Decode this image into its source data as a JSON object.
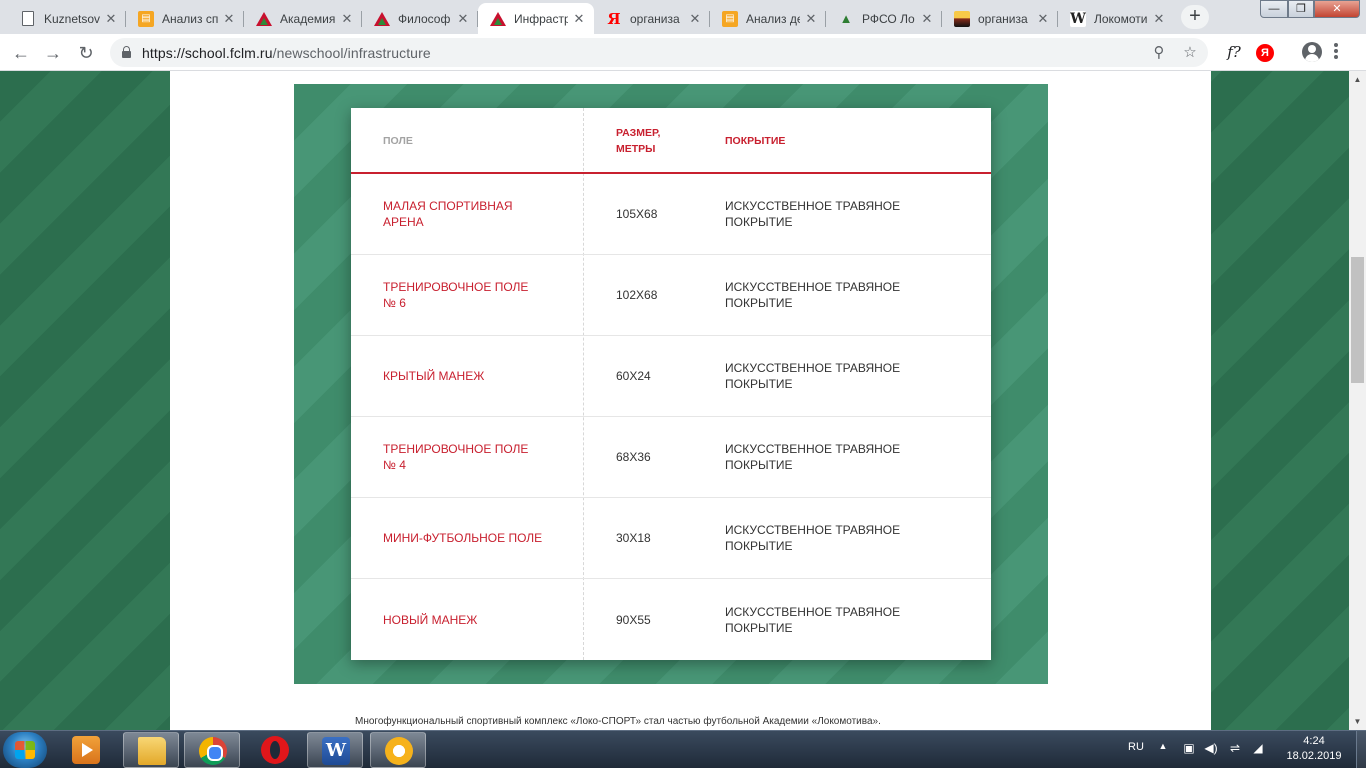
{
  "browser": {
    "tabs": [
      {
        "title": "Kuznetsov",
        "icon": "doc-icon",
        "active": false
      },
      {
        "title": "Анализ сп",
        "icon": "orange-doc-icon",
        "active": false
      },
      {
        "title": "Академия",
        "icon": "lokomotiv-icon",
        "active": false
      },
      {
        "title": "Философ",
        "icon": "lokomotiv-icon",
        "active": false
      },
      {
        "title": "Инфрастр",
        "icon": "lokomotiv-icon",
        "active": true
      },
      {
        "title": "организа",
        "icon": "yandex-icon",
        "active": false
      },
      {
        "title": "Анализ де",
        "icon": "orange-doc-icon",
        "active": false
      },
      {
        "title": "РФСО Ло",
        "icon": "tree-icon",
        "active": false
      },
      {
        "title": "организа",
        "icon": "image-icon",
        "active": false
      },
      {
        "title": "Локомоти",
        "icon": "wikipedia-icon",
        "active": false
      }
    ],
    "url_scheme_host": "https://school.fclm.ru",
    "url_path": "/newschool/infrastructure",
    "ext_fx": "f?",
    "ext_ya": "Я"
  },
  "table": {
    "headers": {
      "field": "ПОЛЕ",
      "size_line1": "РАЗМЕР,",
      "size_line2": "МЕТРЫ",
      "cover": "ПОКРЫТИЕ"
    },
    "rows": [
      {
        "name": "МАЛАЯ СПОРТИВНАЯ АРЕНА",
        "size": "105Х68",
        "cover": "ИСКУССТВЕННОЕ ТРАВЯНОЕ ПОКРЫТИЕ"
      },
      {
        "name": "ТРЕНИРОВОЧНОЕ ПОЛЕ № 6",
        "size": "102Х68",
        "cover": "ИСКУССТВЕННОЕ ТРАВЯНОЕ ПОКРЫТИЕ"
      },
      {
        "name": "КРЫТЫЙ МАНЕЖ",
        "size": "60Х24",
        "cover": "ИСКУССТВЕННОЕ ТРАВЯНОЕ ПОКРЫТИЕ"
      },
      {
        "name": "ТРЕНИРОВОЧНОЕ ПОЛЕ № 4",
        "size": "68Х36",
        "cover": "ИСКУССТВЕННОЕ ТРАВЯНОЕ ПОКРЫТИЕ"
      },
      {
        "name": "МИНИ-ФУТБОЛЬНОЕ ПОЛЕ",
        "size": "30Х18",
        "cover": "ИСКУССТВЕННОЕ ТРАВЯНОЕ ПОКРЫТИЕ"
      },
      {
        "name": "НОВЫЙ МАНЕЖ",
        "size": "90Х55",
        "cover": "ИСКУССТВЕННОЕ ТРАВЯНОЕ ПОКРЫТИЕ"
      }
    ]
  },
  "footer_text": "Многофункциональный спортивный комплекс «Локо-СПОРТ» стал частью футбольной Академии «Локомотива».",
  "taskbar": {
    "apps": [
      "media-player-icon",
      "folder-icon",
      "chrome-icon",
      "opera-icon",
      "word-icon",
      "vpn-icon"
    ],
    "lang": "RU",
    "time": "4:24",
    "date": "18.02.2019"
  },
  "colors": {
    "accent": "#c8202f",
    "panel_green": "#3f8c6b",
    "bg_green": "#2c6e4e"
  }
}
